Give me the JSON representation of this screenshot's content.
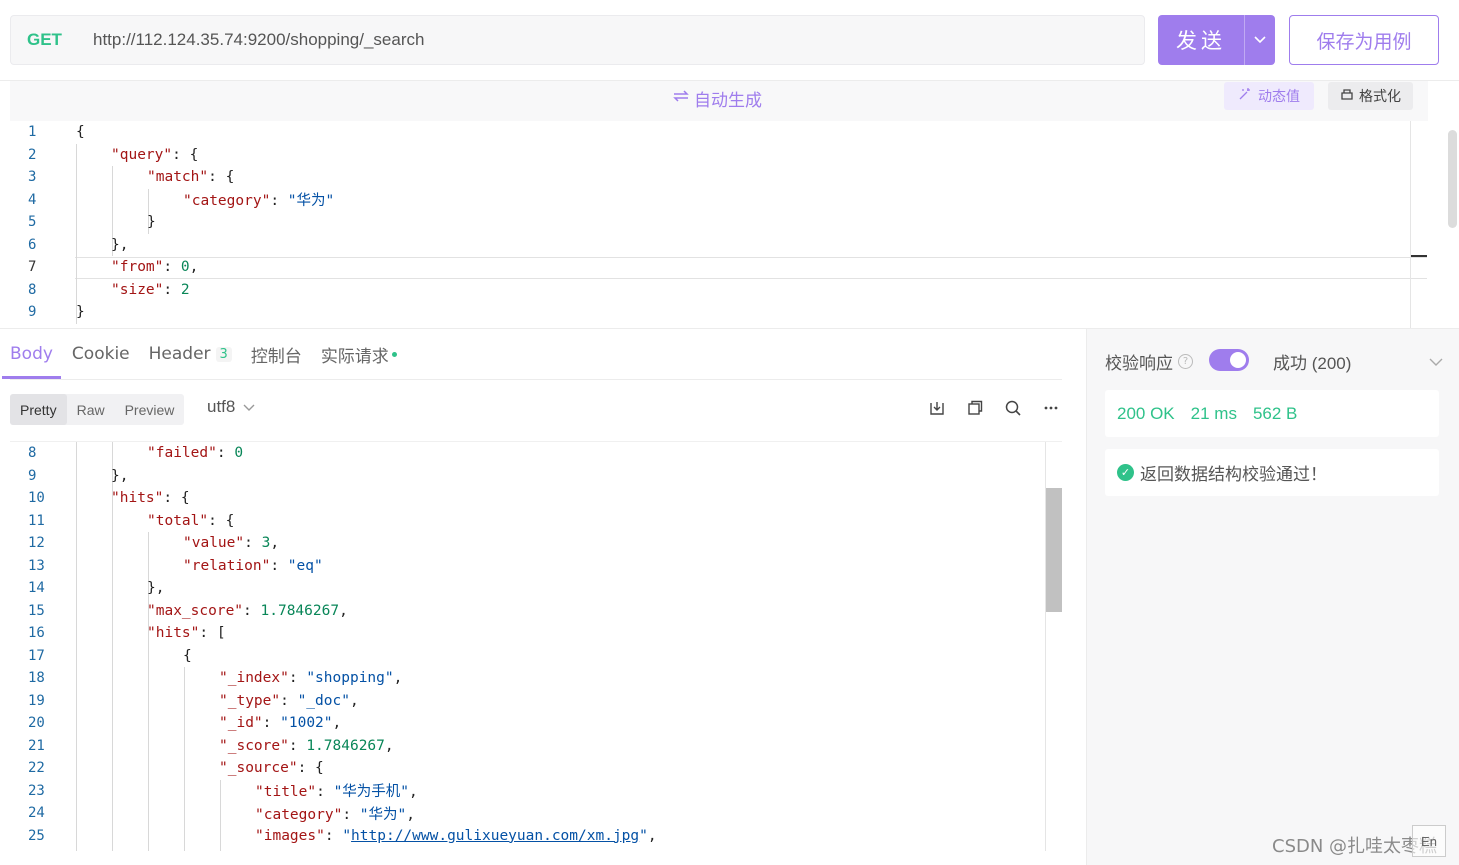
{
  "request": {
    "method": "GET",
    "url": "http://112.124.35.74:9200/shopping/_search",
    "send_label": "发送",
    "save_label": "保存为用例"
  },
  "editor_toolbar": {
    "auto_generate": "自动生成",
    "dynamic_value": "动态值",
    "format": "格式化"
  },
  "request_body": {
    "active_line": 7,
    "lines": [
      {
        "n": "1"
      },
      {
        "n": "2"
      },
      {
        "n": "3"
      },
      {
        "n": "4"
      },
      {
        "n": "5"
      },
      {
        "n": "6"
      },
      {
        "n": "7"
      },
      {
        "n": "8"
      },
      {
        "n": "9"
      }
    ],
    "text": {
      "q_key": "\"query\"",
      "match_key": "\"match\"",
      "category_key": "\"category\"",
      "category_val": "\"华为\"",
      "from_key": "\"from\"",
      "from_val": "0",
      "size_key": "\"size\"",
      "size_val": "2"
    }
  },
  "response_tabs": {
    "body": "Body",
    "cookie": "Cookie",
    "header": "Header",
    "header_count": "3",
    "console": "控制台",
    "actual_request": "实际请求"
  },
  "view_modes": {
    "pretty": "Pretty",
    "raw": "Raw",
    "preview": "Preview",
    "selected": "Pretty"
  },
  "encoding": "utf8",
  "response_body": {
    "line_numbers": [
      "8",
      "9",
      "10",
      "11",
      "12",
      "13",
      "14",
      "15",
      "16",
      "17",
      "18",
      "19",
      "20",
      "21",
      "22",
      "23",
      "24",
      "25"
    ],
    "text": {
      "failed_key": "\"failed\"",
      "failed_val": "0",
      "hits_key": "\"hits\"",
      "total_key": "\"total\"",
      "value_key": "\"value\"",
      "value_val": "3",
      "relation_key": "\"relation\"",
      "relation_val": "\"eq\"",
      "max_score_key": "\"max_score\"",
      "max_score_val": "1.7846267",
      "hits2_key": "\"hits\"",
      "index_key": "\"_index\"",
      "index_val": "\"shopping\"",
      "type_key": "\"_type\"",
      "type_val": "\"_doc\"",
      "id_key": "\"_id\"",
      "id_val": "\"1002\"",
      "score_key": "\"_score\"",
      "score_val": "1.7846267",
      "source_key": "\"_source\"",
      "title_key": "\"title\"",
      "title_val": "\"华为手机\"",
      "cat_key": "\"category\"",
      "cat_val": "\"华为\"",
      "images_key": "\"images\"",
      "images_url": "http://www.gulixueyuan.com/xm.jpg"
    }
  },
  "validation": {
    "title": "校验响应",
    "enabled": true,
    "selected": "成功 (200)",
    "status": "200 OK",
    "time": "21 ms",
    "size": "562 B",
    "message": "返回数据结构校验通过！"
  },
  "watermark": "CSDN @扎哇太枣糕",
  "corner_label": "En",
  "colors": {
    "accent": "#9f7ded",
    "success": "#2fc28a",
    "key": "#a31515",
    "string": "#0451a5",
    "number": "#098658"
  }
}
